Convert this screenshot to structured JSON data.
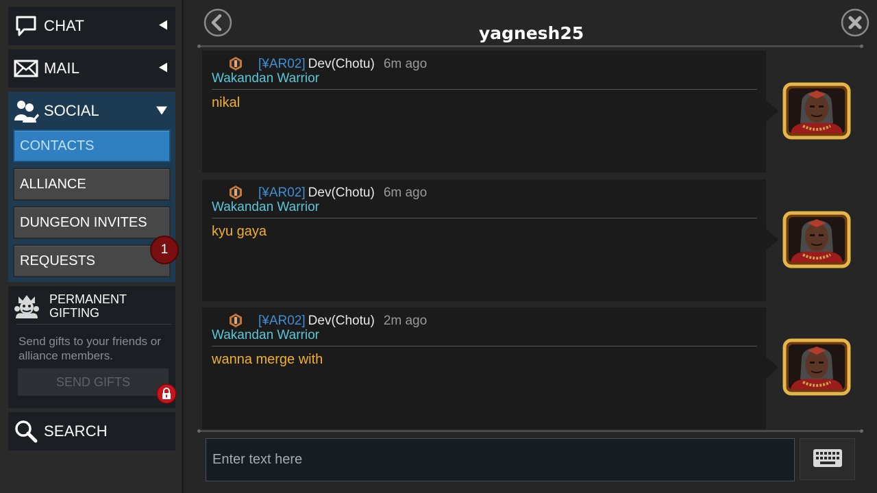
{
  "sidebar": {
    "chat_label": "CHAT",
    "mail_label": "MAIL",
    "social_label": "SOCIAL",
    "social_items": [
      {
        "label": "CONTACTS",
        "active": true
      },
      {
        "label": "ALLIANCE",
        "active": false
      },
      {
        "label": "DUNGEON INVITES",
        "active": false
      },
      {
        "label": "REQUESTS",
        "active": false
      }
    ],
    "requests_badge": "1",
    "gifting": {
      "title_line1": "PERMANENT",
      "title_line2": "GIFTING",
      "description": "Send gifts to your friends or alliance members.",
      "button_label": "SEND GIFTS",
      "button_locked": true
    },
    "search_label": "SEARCH"
  },
  "chat": {
    "title": "yagnesh25",
    "messages": [
      {
        "tag": "[¥AR02]",
        "sender": "Dev(Chotu)",
        "time": "6m ago",
        "subtitle": "Wakandan Warrior",
        "text": "nikal"
      },
      {
        "tag": "[¥AR02]",
        "sender": "Dev(Chotu)",
        "time": "6m ago",
        "subtitle": "Wakandan Warrior",
        "text": "kyu gaya"
      },
      {
        "tag": "[¥AR02]",
        "sender": "Dev(Chotu)",
        "time": "2m ago",
        "subtitle": "Wakandan Warrior",
        "text": "wanna merge with"
      }
    ],
    "input_placeholder": "Enter text here"
  },
  "icons": {
    "chat": "speech-bubble-icon",
    "mail": "envelope-icon",
    "social": "people-icon",
    "collapsed_arrow": "triangle-left-icon",
    "expanded_arrow": "triangle-down-icon",
    "gifting": "gift-character-icon",
    "lock": "lock-icon",
    "search": "magnifier-icon",
    "back": "chevron-left-circle-icon",
    "close": "close-circle-icon",
    "emblem": "alliance-emblem-icon",
    "keyboard": "keyboard-icon"
  },
  "colors": {
    "active_tab": "#2f7fc1",
    "alliance_tag": "#3d8fd3",
    "subtitle": "#58c8d8",
    "message_text": "#f0b12a",
    "badge": "#7a0f12"
  }
}
